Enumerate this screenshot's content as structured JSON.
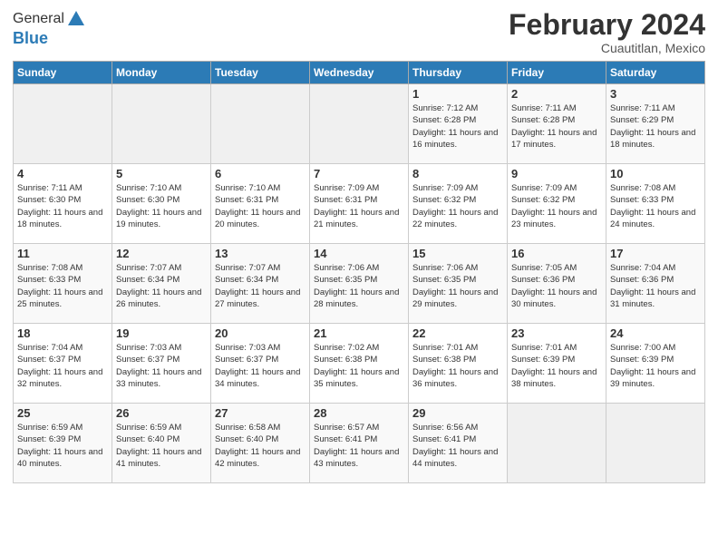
{
  "header": {
    "logo_general": "General",
    "logo_blue": "Blue",
    "month_title": "February 2024",
    "subtitle": "Cuautitlan, Mexico"
  },
  "columns": [
    "Sunday",
    "Monday",
    "Tuesday",
    "Wednesday",
    "Thursday",
    "Friday",
    "Saturday"
  ],
  "weeks": [
    [
      {
        "day": "",
        "info": ""
      },
      {
        "day": "",
        "info": ""
      },
      {
        "day": "",
        "info": ""
      },
      {
        "day": "",
        "info": ""
      },
      {
        "day": "1",
        "info": "Sunrise: 7:12 AM\nSunset: 6:28 PM\nDaylight: 11 hours and 16 minutes."
      },
      {
        "day": "2",
        "info": "Sunrise: 7:11 AM\nSunset: 6:28 PM\nDaylight: 11 hours and 17 minutes."
      },
      {
        "day": "3",
        "info": "Sunrise: 7:11 AM\nSunset: 6:29 PM\nDaylight: 11 hours and 18 minutes."
      }
    ],
    [
      {
        "day": "4",
        "info": "Sunrise: 7:11 AM\nSunset: 6:30 PM\nDaylight: 11 hours and 18 minutes."
      },
      {
        "day": "5",
        "info": "Sunrise: 7:10 AM\nSunset: 6:30 PM\nDaylight: 11 hours and 19 minutes."
      },
      {
        "day": "6",
        "info": "Sunrise: 7:10 AM\nSunset: 6:31 PM\nDaylight: 11 hours and 20 minutes."
      },
      {
        "day": "7",
        "info": "Sunrise: 7:09 AM\nSunset: 6:31 PM\nDaylight: 11 hours and 21 minutes."
      },
      {
        "day": "8",
        "info": "Sunrise: 7:09 AM\nSunset: 6:32 PM\nDaylight: 11 hours and 22 minutes."
      },
      {
        "day": "9",
        "info": "Sunrise: 7:09 AM\nSunset: 6:32 PM\nDaylight: 11 hours and 23 minutes."
      },
      {
        "day": "10",
        "info": "Sunrise: 7:08 AM\nSunset: 6:33 PM\nDaylight: 11 hours and 24 minutes."
      }
    ],
    [
      {
        "day": "11",
        "info": "Sunrise: 7:08 AM\nSunset: 6:33 PM\nDaylight: 11 hours and 25 minutes."
      },
      {
        "day": "12",
        "info": "Sunrise: 7:07 AM\nSunset: 6:34 PM\nDaylight: 11 hours and 26 minutes."
      },
      {
        "day": "13",
        "info": "Sunrise: 7:07 AM\nSunset: 6:34 PM\nDaylight: 11 hours and 27 minutes."
      },
      {
        "day": "14",
        "info": "Sunrise: 7:06 AM\nSunset: 6:35 PM\nDaylight: 11 hours and 28 minutes."
      },
      {
        "day": "15",
        "info": "Sunrise: 7:06 AM\nSunset: 6:35 PM\nDaylight: 11 hours and 29 minutes."
      },
      {
        "day": "16",
        "info": "Sunrise: 7:05 AM\nSunset: 6:36 PM\nDaylight: 11 hours and 30 minutes."
      },
      {
        "day": "17",
        "info": "Sunrise: 7:04 AM\nSunset: 6:36 PM\nDaylight: 11 hours and 31 minutes."
      }
    ],
    [
      {
        "day": "18",
        "info": "Sunrise: 7:04 AM\nSunset: 6:37 PM\nDaylight: 11 hours and 32 minutes."
      },
      {
        "day": "19",
        "info": "Sunrise: 7:03 AM\nSunset: 6:37 PM\nDaylight: 11 hours and 33 minutes."
      },
      {
        "day": "20",
        "info": "Sunrise: 7:03 AM\nSunset: 6:37 PM\nDaylight: 11 hours and 34 minutes."
      },
      {
        "day": "21",
        "info": "Sunrise: 7:02 AM\nSunset: 6:38 PM\nDaylight: 11 hours and 35 minutes."
      },
      {
        "day": "22",
        "info": "Sunrise: 7:01 AM\nSunset: 6:38 PM\nDaylight: 11 hours and 36 minutes."
      },
      {
        "day": "23",
        "info": "Sunrise: 7:01 AM\nSunset: 6:39 PM\nDaylight: 11 hours and 38 minutes."
      },
      {
        "day": "24",
        "info": "Sunrise: 7:00 AM\nSunset: 6:39 PM\nDaylight: 11 hours and 39 minutes."
      }
    ],
    [
      {
        "day": "25",
        "info": "Sunrise: 6:59 AM\nSunset: 6:39 PM\nDaylight: 11 hours and 40 minutes."
      },
      {
        "day": "26",
        "info": "Sunrise: 6:59 AM\nSunset: 6:40 PM\nDaylight: 11 hours and 41 minutes."
      },
      {
        "day": "27",
        "info": "Sunrise: 6:58 AM\nSunset: 6:40 PM\nDaylight: 11 hours and 42 minutes."
      },
      {
        "day": "28",
        "info": "Sunrise: 6:57 AM\nSunset: 6:41 PM\nDaylight: 11 hours and 43 minutes."
      },
      {
        "day": "29",
        "info": "Sunrise: 6:56 AM\nSunset: 6:41 PM\nDaylight: 11 hours and 44 minutes."
      },
      {
        "day": "",
        "info": ""
      },
      {
        "day": "",
        "info": ""
      }
    ]
  ]
}
